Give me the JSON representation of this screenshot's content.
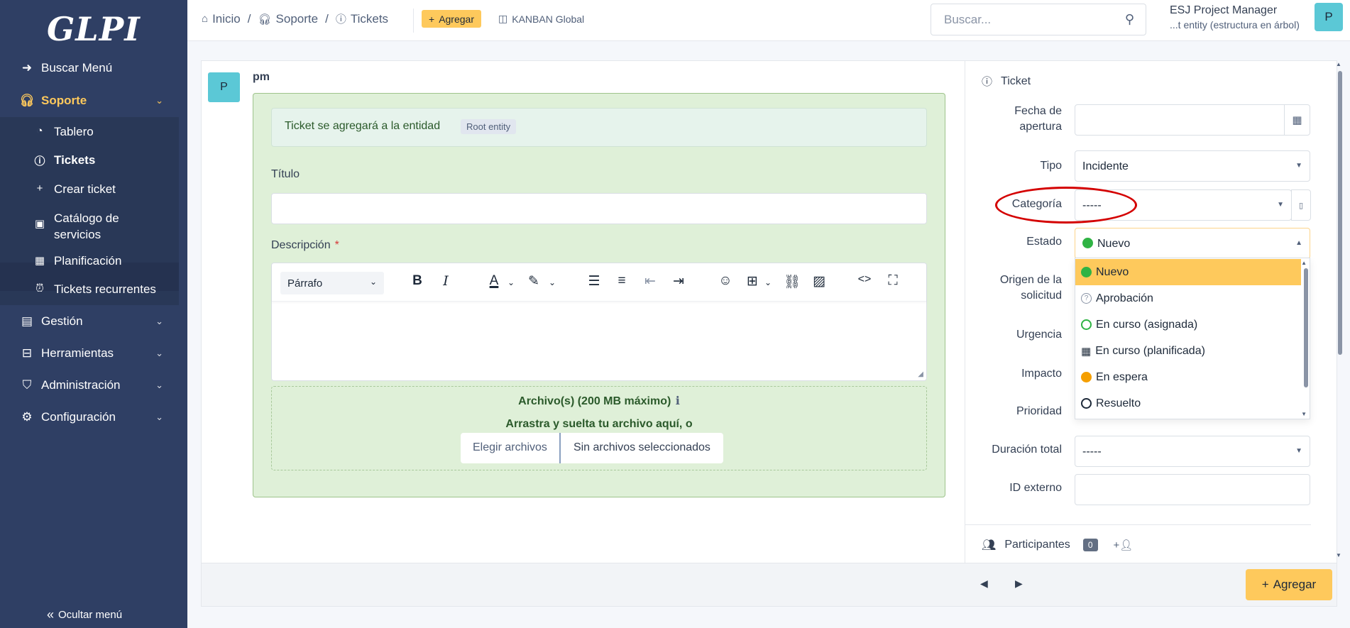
{
  "sidebar": {
    "logo": "GLPI",
    "items": [
      {
        "label": "Buscar Menú",
        "icon": "arrow-right-icon"
      },
      {
        "label": "Soporte",
        "icon": "headset-icon",
        "active": true
      },
      {
        "label": "Gestión",
        "icon": "wallet-icon"
      },
      {
        "label": "Herramientas",
        "icon": "briefcase-icon"
      },
      {
        "label": "Administración",
        "icon": "shield-icon"
      },
      {
        "label": "Configuración",
        "icon": "gear-icon"
      }
    ],
    "submenu": [
      {
        "label": "Tablero",
        "icon": "dashboard-icon"
      },
      {
        "label": "Tickets",
        "icon": "alert-circle-icon",
        "selected": true
      },
      {
        "label": "Crear ticket",
        "icon": "plus-icon"
      },
      {
        "label": "Catálogo de",
        "label2": "servicios",
        "icon": "catalog-icon"
      },
      {
        "label": "Planificación",
        "icon": "calendar-icon"
      },
      {
        "label": "Tickets recurrentes",
        "icon": "alarm-icon"
      }
    ],
    "collapse_label": "Ocultar menú"
  },
  "header": {
    "breadcrumbs": [
      "Inicio",
      "Soporte",
      "Tickets"
    ],
    "add_label": "Agregar",
    "kanban_label": "KANBAN Global",
    "search_placeholder": "Buscar...",
    "user_name": "ESJ Project Manager",
    "user_entity": "...t entity (estructura en árbol)",
    "user_initial": "P"
  },
  "form": {
    "author_initial": "P",
    "author": "pm",
    "notice_text": "Ticket se agregará a la entidad",
    "notice_badge": "Root entity",
    "title_label": "Título",
    "description_label": "Descripción",
    "required_mark": "*",
    "paragraph_select": "Párrafo",
    "files_title": "Archivo(s) (200 MB máximo)",
    "files_drop": "Arrastra y suelta tu archivo aquí, o",
    "choose_files": "Elegir archivos",
    "no_files": "Sin archivos seleccionados"
  },
  "right_panel": {
    "section_title": "Ticket",
    "fields": {
      "fecha_label_1": "Fecha de",
      "fecha_label_2": "apertura",
      "fecha_value": "",
      "tipo_label": "Tipo",
      "tipo_value": "Incidente",
      "categoria_label": "Categoría",
      "categoria_value": "-----",
      "estado_label": "Estado",
      "estado_value": "Nuevo",
      "origen_label_1": "Origen de la",
      "origen_label_2": "solicitud",
      "urgencia_label": "Urgencia",
      "impacto_label": "Impacto",
      "prioridad_label": "Prioridad",
      "duracion_label": "Duración total",
      "duracion_value": "-----",
      "id_externo_label": "ID externo",
      "id_externo_value": ""
    },
    "estado_options": [
      {
        "label": "Nuevo",
        "icon": "green-dot-icon",
        "color": "#2fb344",
        "selected": true
      },
      {
        "label": "Aprobación",
        "icon": "question-circle-icon",
        "color": "#8a94a6"
      },
      {
        "label": "En curso (asignada)",
        "icon": "green-circle-outline-icon",
        "color": "#2fb344"
      },
      {
        "label": "En curso (planificada)",
        "icon": "calendar-small-icon",
        "color": "#1d2939"
      },
      {
        "label": "En espera",
        "icon": "orange-dot-icon",
        "color": "#f59f00"
      },
      {
        "label": "Resuelto",
        "icon": "black-circle-outline-icon",
        "color": "#1d2939"
      }
    ],
    "participants_label": "Participantes",
    "participants_count": "0"
  },
  "footer": {
    "add_label": "Agregar"
  },
  "colors": {
    "sidebar_bg": "#2f3f64",
    "accent": "#fec95c",
    "success_bg": "#dff0d8",
    "annotation_red": "#d40000"
  }
}
